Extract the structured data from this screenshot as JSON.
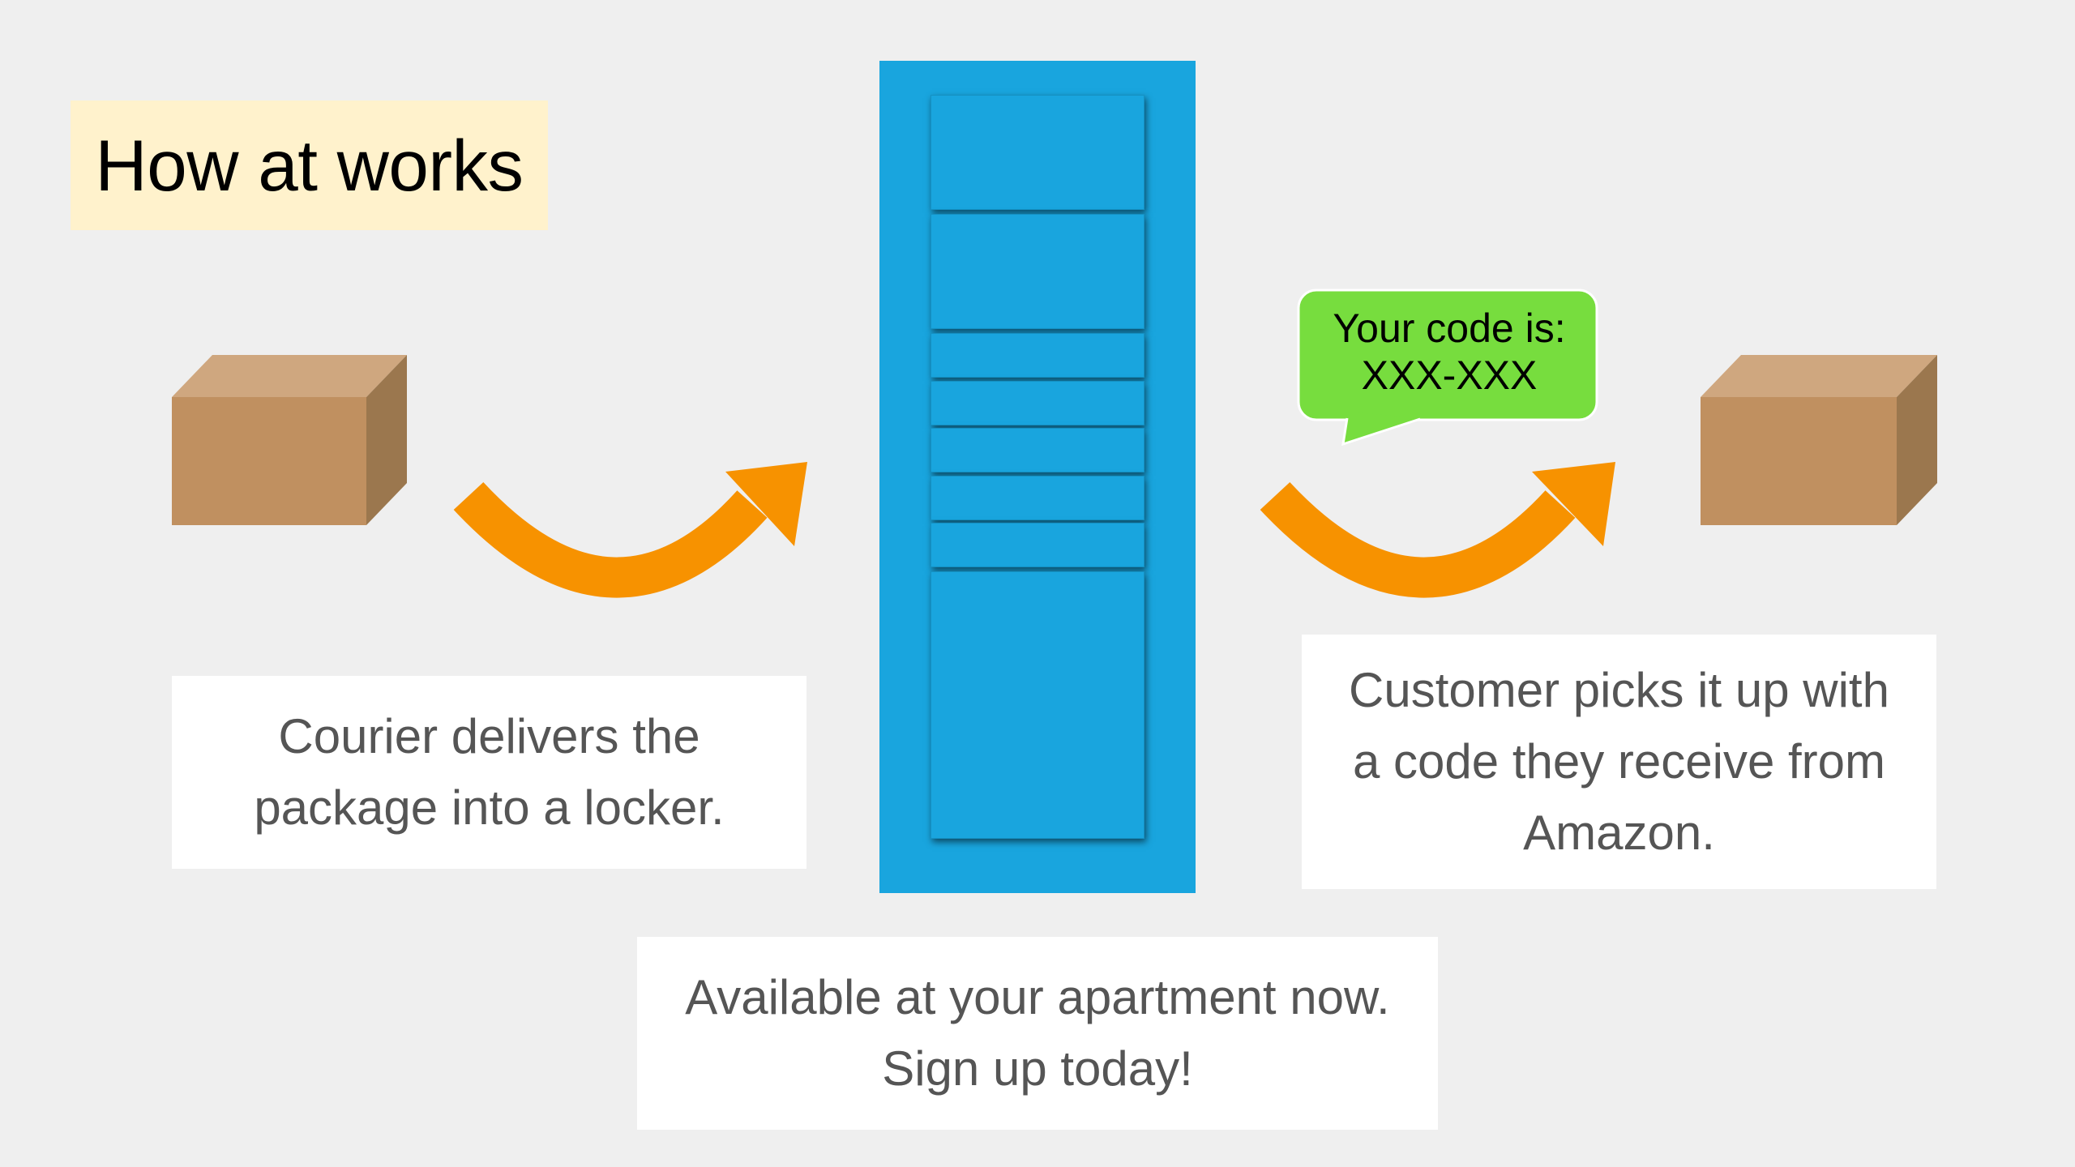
{
  "title": "How at works",
  "steps": {
    "courier": [
      "Courier delivers the",
      "package into a locker."
    ],
    "customer": [
      "Customer picks it up with",
      "a code they receive from",
      "Amazon."
    ]
  },
  "cta": [
    "Available at your apartment now.",
    "Sign up today!"
  ],
  "code_bubble": {
    "line1": "Your code is:",
    "line2": "XXX-XXX"
  },
  "icons": {
    "left_package": "package-box-icon",
    "right_package": "package-box-icon",
    "arrows": "curved-arrow-icon",
    "locker": "locker-icon",
    "bubble": "speech-bubble-icon"
  },
  "colors": {
    "background": "#efefef",
    "title_highlight": "#fff2cc",
    "locker_blue": "#19a5de",
    "arrow_orange": "#f79200",
    "bubble_green": "#77dd3e",
    "box_front": "#c09060",
    "box_top": "#cfa77f",
    "box_side": "#9b774e",
    "text_gray": "#555555"
  }
}
